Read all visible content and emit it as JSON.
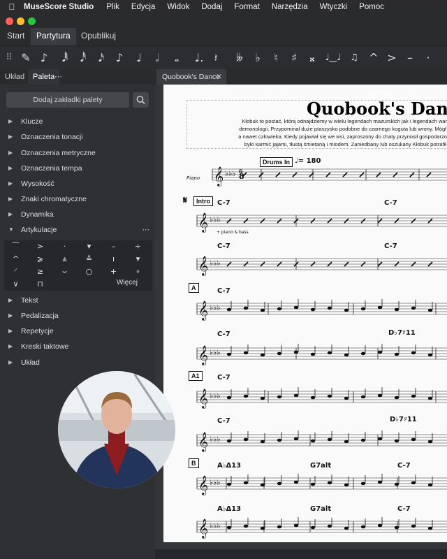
{
  "menubar": {
    "app": "MuseScore Studio",
    "items": [
      "Plik",
      "Edycja",
      "Widok",
      "Dodaj",
      "Format",
      "Narzędzia",
      "Wtyczki",
      "Pomoc"
    ]
  },
  "tabs": [
    "Start",
    "Partytura",
    "Opublikuj"
  ],
  "active_tab": "Partytura",
  "panel_tabs": {
    "layout": "Układ",
    "palette": "Paleta",
    "more": "⋯"
  },
  "palette": {
    "add_button": "Dodaj zakładki palety",
    "items": [
      "Klucze",
      "Oznaczenia tonacji",
      "Oznaczenia metryczne",
      "Oznaczenia tempa",
      "Wysokość",
      "Znaki chromatyczne",
      "Dynamika",
      "Artykulacje",
      "Tekst",
      "Pedalizacja",
      "Repetycje",
      "Kreski taktowe",
      "Układ"
    ],
    "expanded": "Artykulacje",
    "more_label": "Więcej"
  },
  "document": {
    "tab_name": "Quobook's Dance",
    "title": "Quobook's Dance",
    "description": [
      "Kłobuk to postać, którą odnajdziemy w wielu legendach mazurskich jak i legendach warmińskich. Te",
      "demonologii. Przypominał duże ptaszysko podobne do czarnego koguta lub wrony. Mógł jednak przybi",
      "a nawet człowieka. Kiedy pojawiał się we wsi, zaproszony do chaty przynosił gospodarzom bogactwa, i",
      "było karmić jajami, tłustą śmietaną i miodem. Zaniedbany lub oszukany Kłobuk potrafił ukarać gos"
    ],
    "staff_label": "Piano",
    "drums_in": "Drums In",
    "tempo": "♩= 180",
    "intro": "Intro",
    "segno": "𝄋",
    "piano_bass": "+ piano & bass",
    "rehearsal": [
      "A",
      "A1",
      "B"
    ],
    "chords": {
      "c7": "C-7",
      "db7": "D♭7♯11",
      "ab": "A♭Δ13",
      "g7": "G7alt"
    }
  }
}
